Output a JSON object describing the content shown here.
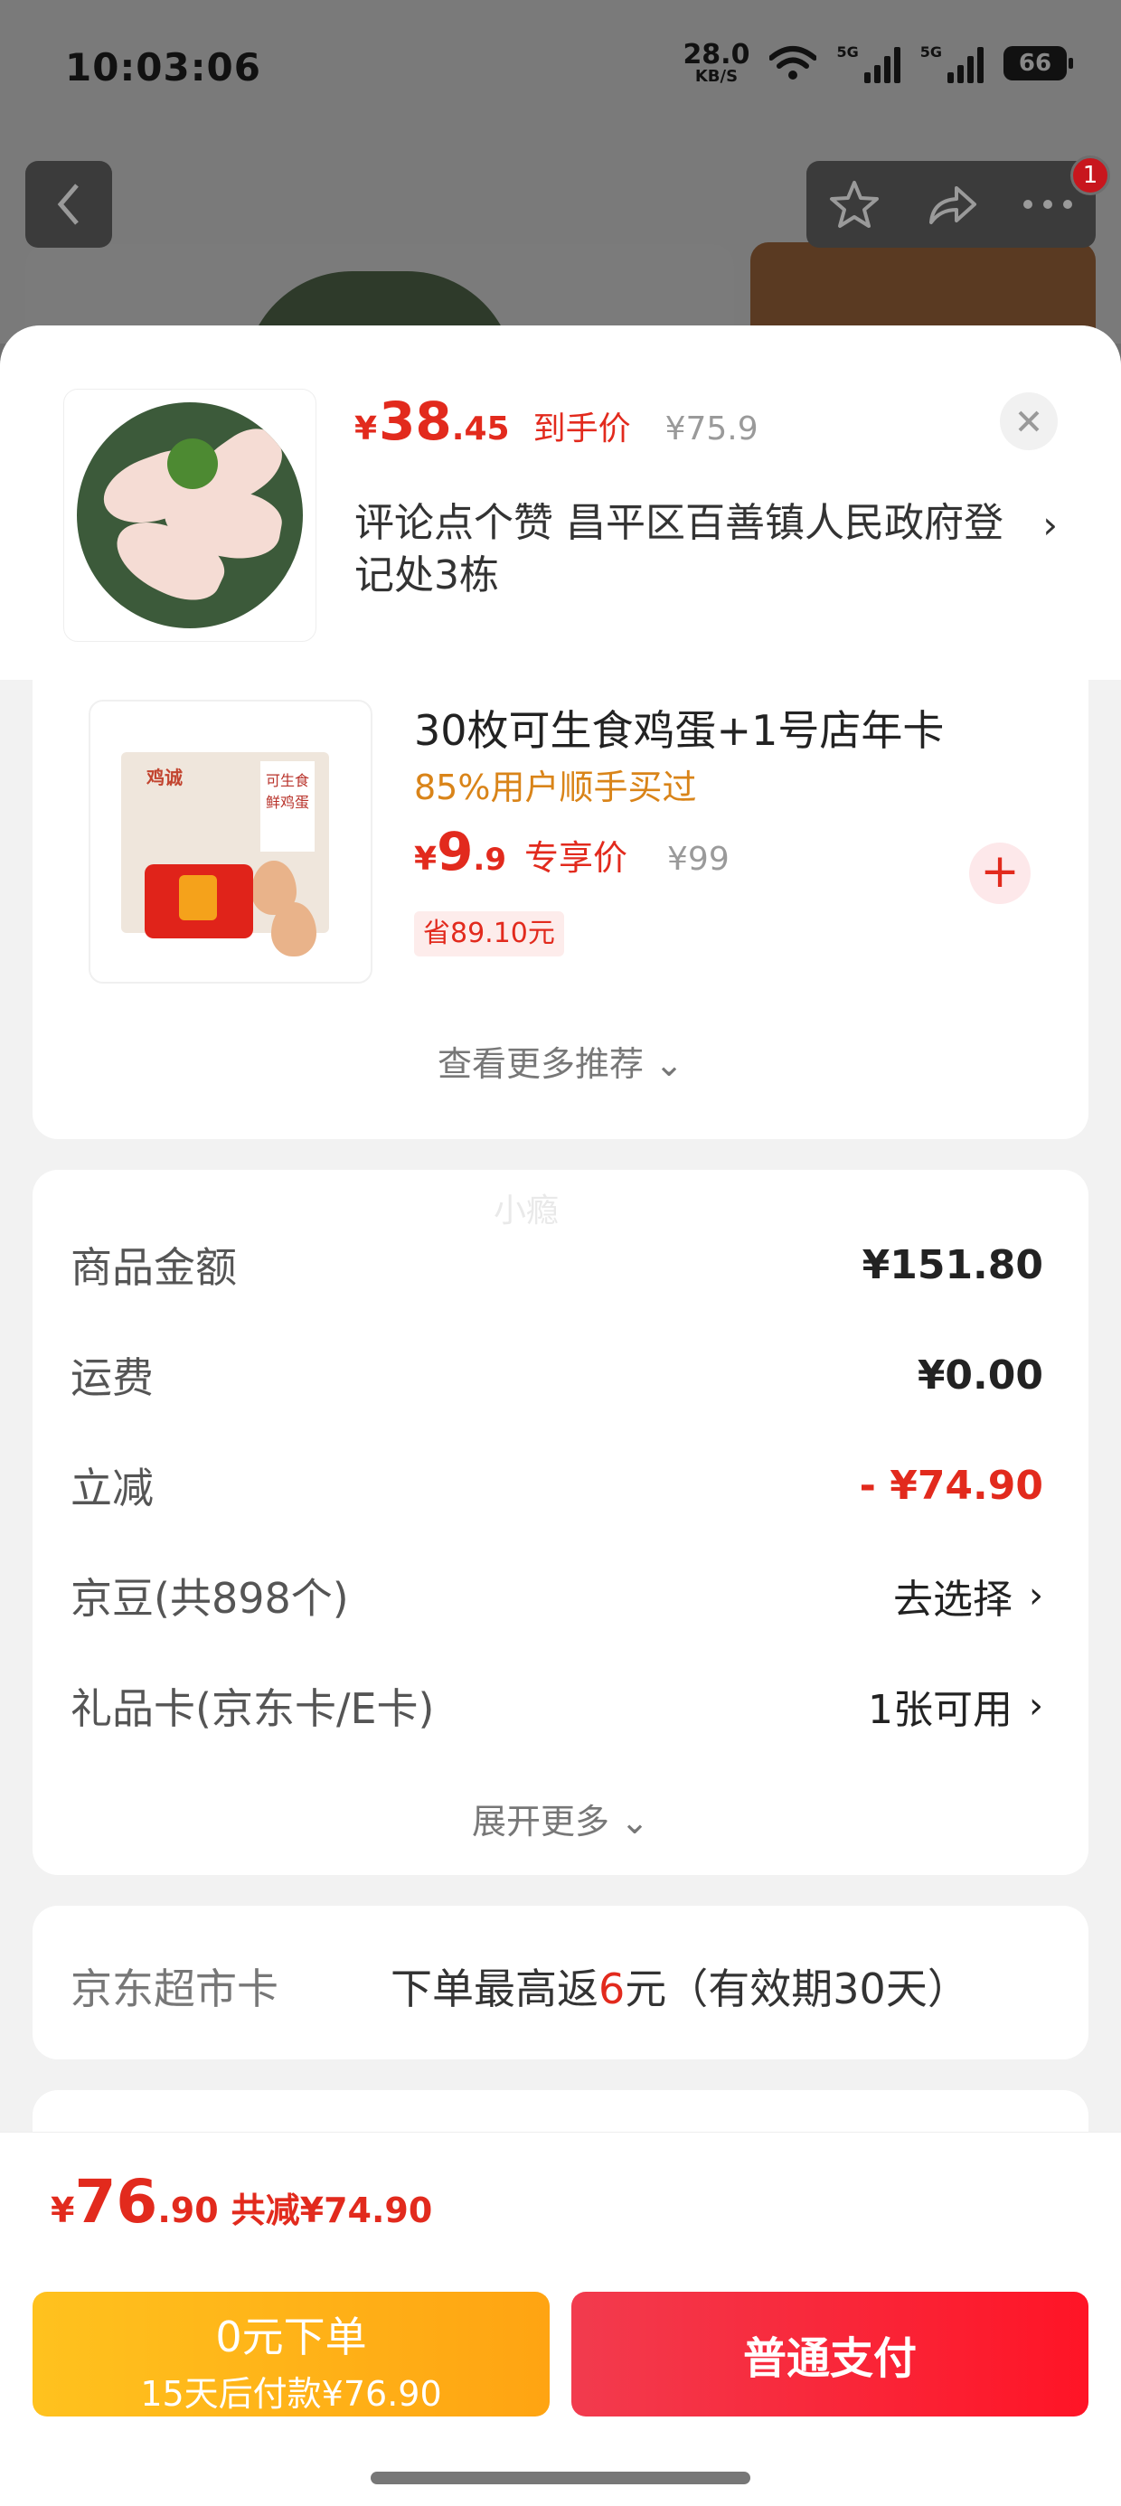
{
  "status": {
    "time": "10:03:06",
    "speed_value": "28.0",
    "speed_unit": "KB/S",
    "battery": "66",
    "net1": "5G",
    "net2": "5G"
  },
  "nav": {
    "badge": "1"
  },
  "header": {
    "price_currency": "¥",
    "price_int": "38",
    "price_dec": ".45",
    "price_tag": "到手价",
    "price_original": "¥75.9",
    "address": "评论点个赞  昌平区百善镇人民政府登记处3栋"
  },
  "recommend": {
    "brand": "鸡诚",
    "side": "可生食鲜鸡蛋",
    "title": "30枚可生食鸡蛋+1号店年卡",
    "subtitle": "85%用户顺手买过",
    "price_currency": "¥",
    "price_int": "9",
    "price_dec": ".9",
    "price_tag": "专享价",
    "price_original": "¥99",
    "save": "省89.10元",
    "more": "查看更多推荐 ⌄"
  },
  "totals": {
    "watermark": "小瘾",
    "rows": [
      {
        "label": "商品金额",
        "value": "¥151.80"
      },
      {
        "label": "运费",
        "value": "¥0.00"
      },
      {
        "label": "立减",
        "value": "- ¥74.90"
      },
      {
        "label": "京豆(共898个)",
        "value": "去选择"
      },
      {
        "label": "礼品卡(京东卡/E卡)",
        "value": "1张可用"
      }
    ],
    "more": "展开更多 ⌄"
  },
  "jd_card": {
    "label": "京东超市卡",
    "pre": "下单最高返",
    "amount": "6",
    "post": "元（有效期30天）"
  },
  "footer": {
    "currency": "¥",
    "total_int": "76",
    "total_dec": ".90",
    "saved": "共减¥74.90",
    "pay_later_title": "0元下单",
    "pay_later_sub": "15天后付款¥76.90",
    "pay_label": "普通支付"
  },
  "colors": {
    "accent_red": "#e22a1d",
    "pay_later": "#ffb319",
    "pay": "#ff2639"
  }
}
